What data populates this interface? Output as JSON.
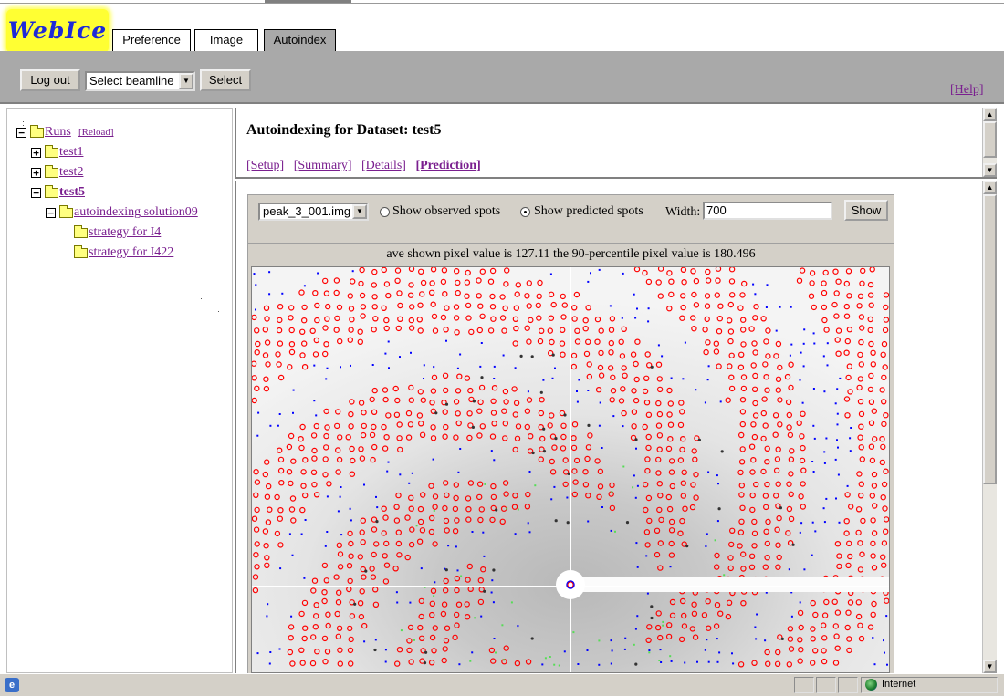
{
  "app": {
    "logo_text": "WebIce"
  },
  "tabs": [
    {
      "label": "Preference",
      "active": false
    },
    {
      "label": "Image",
      "active": false
    },
    {
      "label": "Autoindex",
      "active": true
    }
  ],
  "toolbar": {
    "logout_label": "Log out",
    "beamline_select": "Select beamline",
    "select_label": "Select",
    "help_label": "[Help]"
  },
  "tree": {
    "root_label": "Runs",
    "reload_label": "[Reload]",
    "items": [
      {
        "label": "test1"
      },
      {
        "label": "test2"
      },
      {
        "label": "test5"
      },
      {
        "label": "autoindexing solution09"
      },
      {
        "label": "strategy for I4"
      },
      {
        "label": "strategy for I422"
      }
    ]
  },
  "main": {
    "title": "Autoindexing for Dataset: test5",
    "links": [
      {
        "label": "[Setup]"
      },
      {
        "label": "[Summary]"
      },
      {
        "label": "[Details]"
      },
      {
        "label": "[Prediction]"
      }
    ]
  },
  "prediction": {
    "image_select": "peak_3_001.img",
    "show_observed_label": "Show observed spots",
    "show_predicted_label": "Show predicted spots",
    "observed_checked": false,
    "predicted_checked": true,
    "width_label": "Width:",
    "width_value": "700",
    "show_button": "Show",
    "pixel_info": "ave shown pixel value is 127.11 the 90-percentile pixel value is 180.496"
  },
  "status_bar": {
    "zone": "Internet"
  },
  "colors": {
    "link": "#7a1f8f",
    "toolbar_bg": "#a9a9a9",
    "logo_bg": "#ffff33",
    "logo_text": "#1e2ad8",
    "predicted_spot": "#ff0000",
    "observed_spot": "#0000ff"
  }
}
